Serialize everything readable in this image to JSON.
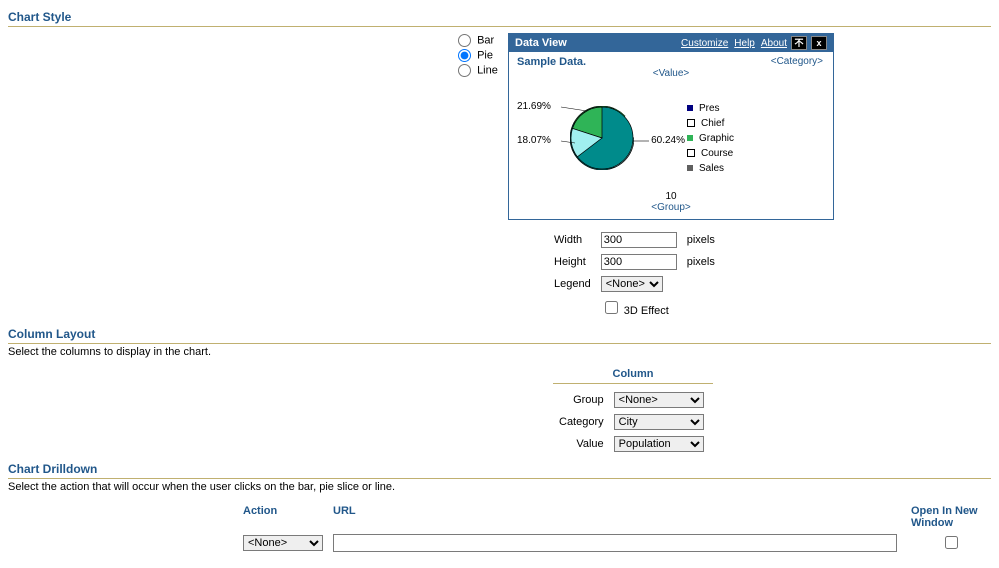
{
  "sections": {
    "chart_style": "Chart Style",
    "column_layout": "Column Layout",
    "column_layout_desc": "Select the columns to display in the chart.",
    "chart_drilldown": "Chart Drilldown",
    "chart_drilldown_desc": "Select the action that will occur when the user clicks on the bar, pie slice or line."
  },
  "chart_type": {
    "options": {
      "bar": "Bar",
      "pie": "Pie",
      "line": "Line"
    },
    "selected": "pie"
  },
  "preview": {
    "title": "Data View",
    "links": {
      "customize": "Customize",
      "help": "Help",
      "about": "About"
    },
    "sample": "Sample Data.",
    "placeholders": {
      "category": "<Category>",
      "value": "<Value>",
      "group": "<Group>"
    },
    "group_value": "10",
    "legend": [
      "Pres",
      "Chief",
      "Graphic",
      "Course",
      "Sales"
    ]
  },
  "chart_data": {
    "type": "pie",
    "title": "Sample Data.",
    "series_name": "<Value>",
    "categories": [
      "60.24%",
      "21.69%",
      "18.07%"
    ],
    "values": [
      60.24,
      21.69,
      18.07
    ],
    "colors": [
      "#008b8b",
      "#2fb457",
      "#a0f0f0"
    ],
    "legend_entries": [
      "Pres",
      "Chief",
      "Graphic",
      "Course",
      "Sales"
    ]
  },
  "dimensions": {
    "width_label": "Width",
    "height_label": "Height",
    "legend_label": "Legend",
    "pixels": "pixels",
    "width": "300",
    "height": "300",
    "legend_value": "<None>",
    "effect_label": "3D Effect",
    "effect_checked": false
  },
  "column_layout": {
    "header": "Column",
    "rows": {
      "group": {
        "label": "Group",
        "value": "<None>"
      },
      "category": {
        "label": "Category",
        "value": "City"
      },
      "value": {
        "label": "Value",
        "value": "Population"
      }
    }
  },
  "drilldown": {
    "headers": {
      "action": "Action",
      "url": "URL",
      "open": "Open In New Window"
    },
    "action_value": "<None>",
    "url_value": "",
    "open_checked": false
  }
}
